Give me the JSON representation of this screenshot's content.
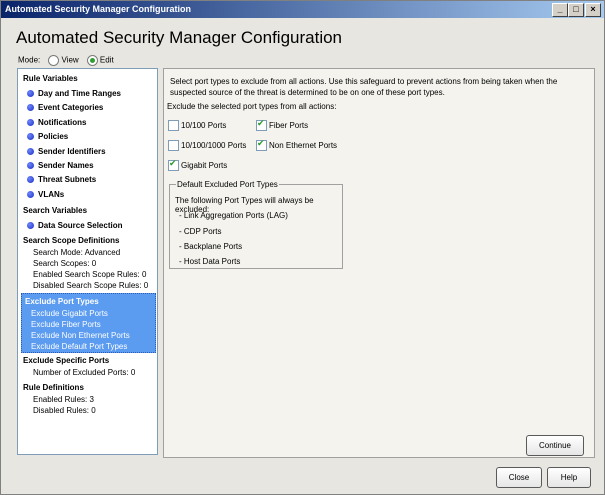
{
  "window": {
    "title": "Automated Security Manager Configuration"
  },
  "heading": "Automated Security Manager Configuration",
  "mode": {
    "label": "Mode:",
    "view": "View",
    "edit": "Edit",
    "selected": "Edit"
  },
  "sidebar": {
    "rule_variables": "Rule Variables",
    "rv_items": [
      "Day and Time Ranges",
      "Event Categories",
      "Notifications",
      "Policies",
      "Sender Identifiers",
      "Sender Names",
      "Threat Subnets",
      "VLANs"
    ],
    "search_variables": "Search Variables",
    "sv_items": [
      "Data Source Selection"
    ],
    "search_scope": "Search Scope Definitions",
    "scope_lines": [
      "Search Mode: Advanced",
      "Search Scopes: 0",
      "Enabled Search Scope Rules: 0",
      "Disabled Search Scope Rules: 0"
    ],
    "exclude_port_types": "Exclude Port Types",
    "ept_lines": [
      "Exclude Gigabit Ports",
      "Exclude Fiber Ports",
      "Exclude Non Ethernet Ports",
      "Exclude Default Port Types"
    ],
    "exclude_specific": "Exclude Specific Ports",
    "es_lines": [
      "Number of Excluded Ports: 0"
    ],
    "rule_defs": "Rule Definitions",
    "rd_lines": [
      "Enabled  Rules: 3",
      "Disabled Rules: 0"
    ]
  },
  "main": {
    "intro1": "Select port types to exclude from all actions.  Use this safeguard to prevent actions from being taken when the",
    "intro2": "suspected source of the threat is determined to be on one of these port types.",
    "exclude_label": "Exclude the selected port types from all actions:",
    "checkboxes": [
      {
        "label": "10/100 Ports",
        "checked": false
      },
      {
        "label": "Fiber Ports",
        "checked": true
      },
      {
        "label": "10/100/1000 Ports",
        "checked": false
      },
      {
        "label": "Non Ethernet Ports",
        "checked": true
      },
      {
        "label": "Gigabit Ports",
        "checked": true
      }
    ],
    "group_title": "Default Excluded Port Types",
    "group_desc": "The following Port Types will always be excluded:",
    "group_items": [
      "- Link Aggregation Ports (LAG)",
      "- CDP Ports",
      "- Backplane Ports",
      "- Host Data Ports"
    ],
    "continue": "Continue"
  },
  "footer": {
    "close": "Close",
    "help": "Help"
  }
}
